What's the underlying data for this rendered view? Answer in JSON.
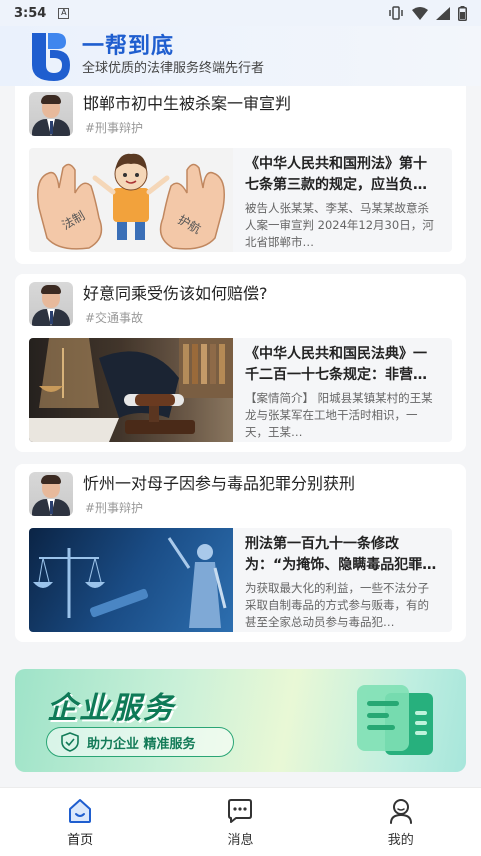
{
  "status_bar": {
    "time": "3:54",
    "notification_badge": "A",
    "icons": [
      "vibrate-icon",
      "wifi-icon",
      "signal-icon",
      "battery-icon"
    ]
  },
  "header": {
    "app_name": "一帮到底",
    "slogan": "全球优质的法律服务终端先行者",
    "accent_color": "#1f5ecf"
  },
  "posts": [
    {
      "title": "邯郸市初中生被杀案一审宣判",
      "tag": "#刑事辩护",
      "excerpt_title": "《中华人民共和国刑法》第十七条第三款的规定，应当负…",
      "excerpt_body": "被告人张某某、李某、马某某故意杀人案一审宣判 2024年12月30日，河北省邯郸市…",
      "thumb_texts": [
        "法制",
        "护航"
      ]
    },
    {
      "title": "好意同乘受伤该如何赔偿?",
      "tag": "#交通事故",
      "excerpt_title": "《中华人民共和国民法典》一千二百一十七条规定：非营…",
      "excerpt_body": "【案情简介】 阳城县某镇某村的王某龙与张某军在工地干活时相识，一天，王某…"
    },
    {
      "title": "忻州一对母子因参与毒品犯罪分别获刑",
      "tag": "#刑事辩护",
      "excerpt_title": "刑法第一百九十一条修改为：“为掩饰、隐瞒毒品犯罪…",
      "excerpt_body": "为获取最大化的利益，一些不法分子采取自制毒品的方式参与贩毒，有的甚至全家总动员参与毒品犯…"
    }
  ],
  "banner": {
    "title": "企业服务",
    "pill_text": "助力企业 精准服务",
    "accent_color": "#137b58"
  },
  "bottom_nav": {
    "items": [
      {
        "label": "首页",
        "icon": "home-icon",
        "active": true
      },
      {
        "label": "消息",
        "icon": "message-icon",
        "active": false
      },
      {
        "label": "我的",
        "icon": "profile-icon",
        "active": false
      }
    ]
  }
}
